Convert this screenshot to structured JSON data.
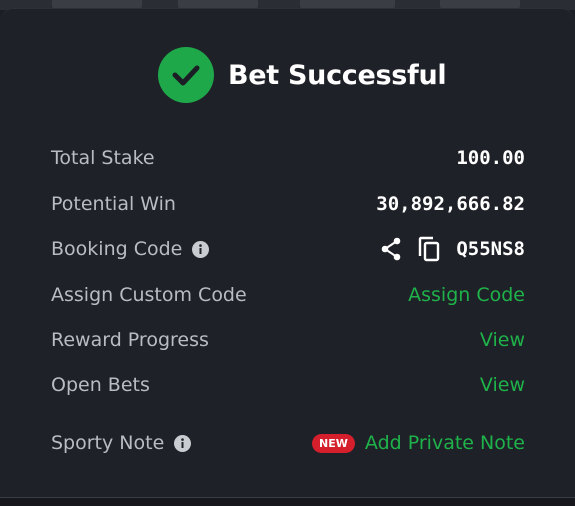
{
  "header": {
    "title": "Bet Successful"
  },
  "rows": {
    "total_stake": {
      "label": "Total Stake",
      "value": "100.00"
    },
    "potential_win": {
      "label": "Potential Win",
      "value": "30,892,666.82"
    },
    "booking_code": {
      "label": "Booking Code",
      "value": "Q55NS8"
    },
    "assign_custom_code": {
      "label": "Assign Custom Code",
      "action": "Assign Code"
    },
    "reward_progress": {
      "label": "Reward Progress",
      "action": "View"
    },
    "open_bets": {
      "label": "Open Bets",
      "action": "View"
    },
    "sporty_note": {
      "label": "Sporty Note",
      "badge": "NEW",
      "action": "Add Private Note"
    }
  },
  "icons": {
    "check": "check-circle-icon",
    "info": "info-icon",
    "share": "share-icon",
    "copy": "copy-icon"
  },
  "colors": {
    "accent_green": "#1fb24a",
    "success_green": "#1fa84a",
    "badge_red": "#d61f2c",
    "background": "#1e2127"
  }
}
